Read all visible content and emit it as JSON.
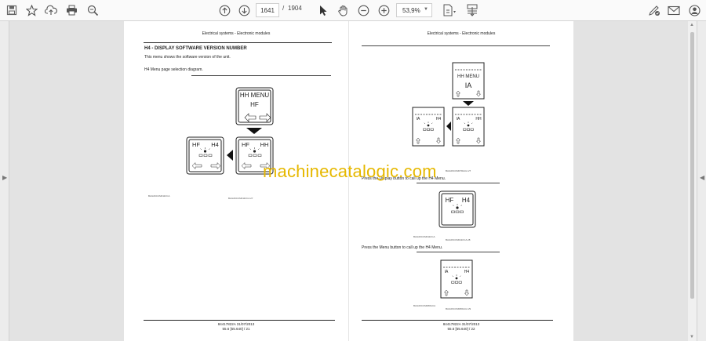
{
  "toolbar": {
    "page_current": "1641",
    "page_separator": "/",
    "page_total": "1904",
    "zoom": "53,9%",
    "icons": [
      "save-icon",
      "bookmark-star-icon",
      "upload-cloud-icon",
      "print-icon",
      "zoom-search-icon",
      "page-up-icon",
      "page-down-icon",
      "select-cursor-icon",
      "hand-pan-icon",
      "zoom-out-icon",
      "zoom-in-icon",
      "fit-page-icon",
      "scroll-mode-icon",
      "sign-pen-icon",
      "mail-icon",
      "account-icon"
    ]
  },
  "left_page": {
    "header": "Electrical systems - Electronic modules",
    "title": "H4 - DISPLAY SOFTWARE VERSION NUMBER",
    "intro": "This menu shows the software version of the unit.",
    "caption": "H4 Menu page selection diagram.",
    "screens": {
      "top": [
        "HH MENU",
        "HF"
      ],
      "bottom_left": [
        "HF",
        "H4"
      ],
      "bottom_right": [
        "HF",
        "HH"
      ]
    },
    "figure_ref": "BAIL06CCM011FCA",
    "figure_num": "BAIL06CCM011FCA   27",
    "footer_code": "84417822A 31/07/2013",
    "footer_page": "55.6 [55.640] / 21"
  },
  "right_page": {
    "header": "Electrical systems - Electronic modules",
    "screens": {
      "top": [
        "HH MENU",
        "IA"
      ],
      "mid_left": [
        "IA",
        "H4"
      ],
      "mid_right": [
        "IA",
        "HH"
      ],
      "step2": [
        "HF",
        "H4"
      ],
      "step3": [
        "IA",
        "H4"
      ]
    },
    "fig1_num": "BAIL06CCM079GCA   27",
    "step2_text": "Press the Display button to call up the H4 Menu.",
    "fig2_ref": "BAIL06CCM011FCA",
    "fig2_num": "BAIL06CCM011FCA   28",
    "step3_text": "Press the Menu button to call up the H4 Menu.",
    "fig3_ref": "BAIL06CCM080GCA",
    "fig3_num": "BAIL06CCM080GCA   29",
    "footer_code": "84417822A 31/07/2013",
    "footer_page": "55.6 [55.640] / 22"
  },
  "watermark": "machinecatalogic.com"
}
